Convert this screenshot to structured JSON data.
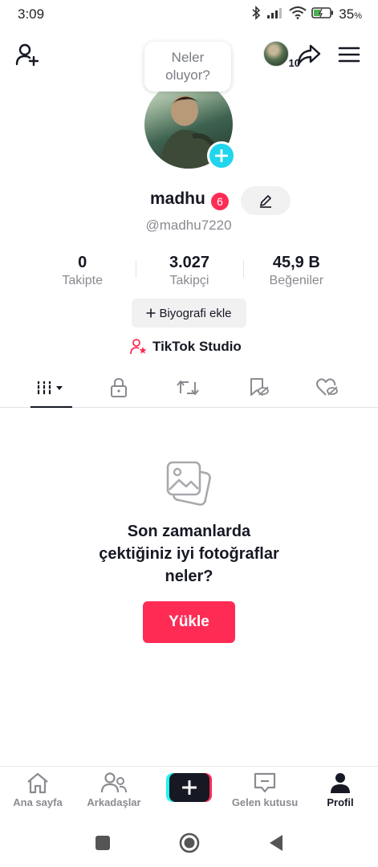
{
  "status_bar": {
    "time": "3:09",
    "battery_pct": "35",
    "battery_unit": "%"
  },
  "top_bar": {
    "story_count": "10"
  },
  "bubble": {
    "line1": "Neler",
    "line2": "oluyor?"
  },
  "profile": {
    "username": "madhu",
    "notification_count": "6",
    "handle": "@madhu7220"
  },
  "stats": [
    {
      "value": "0",
      "label": "Takipte"
    },
    {
      "value": "3.027",
      "label": "Takipçi"
    },
    {
      "value": "45,9 B",
      "label": "Beğeniler"
    }
  ],
  "bio_button": "Biyografi ekle",
  "studio_link": "TikTok Studio",
  "empty_state": {
    "title_line1": "Son zamanlarda",
    "title_line2": "çektiğiniz iyi fotoğraflar",
    "title_line3": "neler?",
    "upload_label": "Yükle"
  },
  "bottom_nav": {
    "home": "Ana sayfa",
    "friends": "Arkadaşlar",
    "inbox": "Gelen kutusu",
    "profile": "Profil"
  },
  "colors": {
    "accent": "#fe2c55",
    "cyan": "#25f4ee",
    "text": "#161823",
    "muted": "#8a8b91"
  }
}
